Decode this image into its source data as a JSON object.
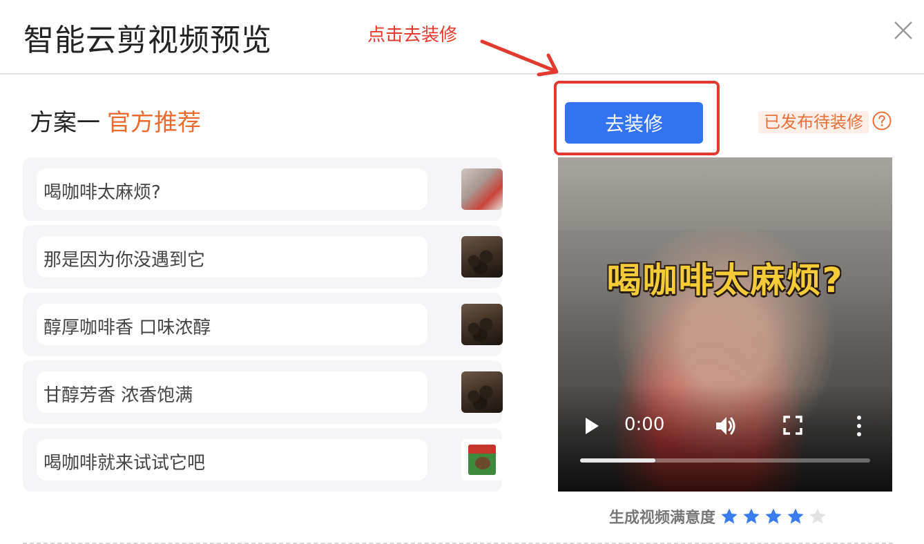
{
  "dialog": {
    "title": "智能云剪视频预览",
    "close_icon": "close-icon"
  },
  "annotation": {
    "text": "点击去装修",
    "color": "#e23a2e"
  },
  "plan": {
    "label": "方案一",
    "tag": "官方推荐",
    "tag_color": "#ec6a2c"
  },
  "scenes": [
    {
      "text": "喝咖啡太麻烦?",
      "thumb": "woman-drinking-coffee"
    },
    {
      "text": "那是因为你没遇到它",
      "thumb": "coffee-beans"
    },
    {
      "text": "醇厚咖啡香 口味浓醇",
      "thumb": "coffee-beans"
    },
    {
      "text": "甘醇芳香 浓香饱满",
      "thumb": "coffee-beans"
    },
    {
      "text": "喝咖啡就来试试它吧",
      "thumb": "coffee-product-box"
    }
  ],
  "actions": {
    "decorate_button": "去装修",
    "button_color": "#3273f2",
    "status_badge": "已发布待装修",
    "help_icon": "question-circle-icon"
  },
  "video": {
    "caption": "喝咖啡太麻烦?",
    "time": "0:00",
    "progress_fraction": 0.26,
    "controls": [
      "play-icon",
      "volume-icon",
      "fullscreen-icon",
      "more-vertical-icon"
    ]
  },
  "rating": {
    "label": "生成视频满意度",
    "value": 4,
    "max": 5,
    "star_color": "#3b7cf0"
  }
}
